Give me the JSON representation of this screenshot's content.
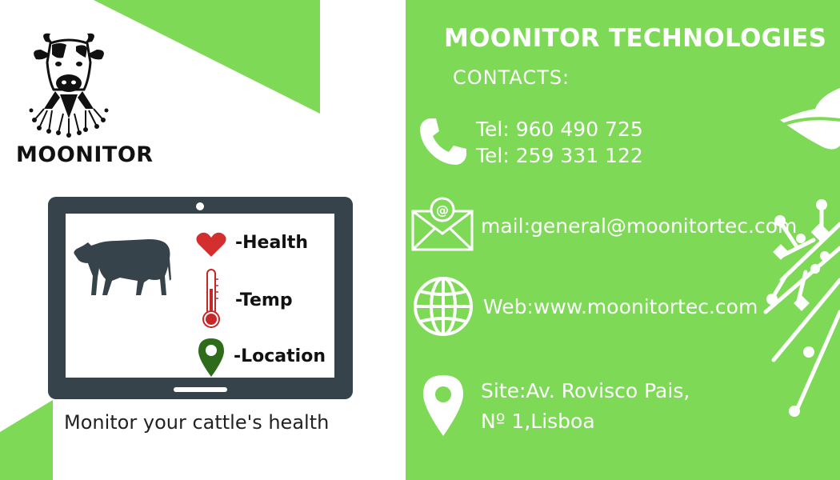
{
  "brand": {
    "name": "MOONITOR"
  },
  "tablet": {
    "metrics": [
      {
        "label": "-Health",
        "icon": "heart-icon"
      },
      {
        "label": "-Temp",
        "icon": "thermometer-icon"
      },
      {
        "label": "-Location",
        "icon": "location-pin-icon"
      }
    ]
  },
  "tagline": "Monitor your cattle's health",
  "company": {
    "title": "MOONITOR TECHNOLOGIES",
    "contacts_heading": "CONTACTS:"
  },
  "contacts": {
    "phones": [
      "Tel: 960 490 725",
      "Tel: 259 331 122"
    ],
    "mail": "mail:general@moonitortec.com",
    "web": "Web:www.moonitortec.com",
    "site_line1": "Site:Av. Rovisco Pais,",
    "site_line2": "Nº 1,Lisboa"
  },
  "colors": {
    "accent": "#7ed957",
    "tablet": "#37434a",
    "heart": "#d32f2f",
    "pin": "#2e6b1a"
  }
}
